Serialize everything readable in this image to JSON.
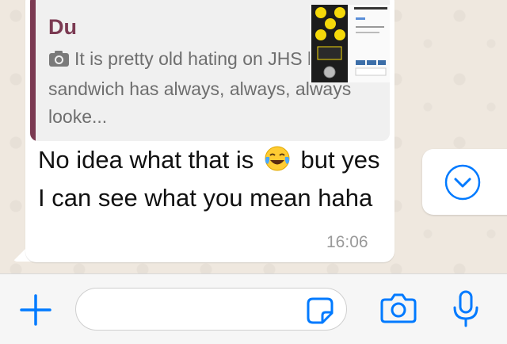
{
  "quote": {
    "author": "Du",
    "text": "It is pretty old hating on JHS but that sandwich has always, always, always looke..."
  },
  "message": {
    "text_before_emoji": "No idea what that is",
    "text_after_emoji": "but yes I can see what you mean haha",
    "emoji": "face-with-tears-of-joy-icon",
    "time": "16:06"
  },
  "colors": {
    "accent": "#007aff",
    "quote_author": "#7b3a52",
    "pedal_yellow": "#f5d90a"
  },
  "icons": {
    "scroll_down": "chevron-down-circle-icon",
    "attach": "plus-icon",
    "sticker": "sticker-icon",
    "camera": "camera-icon",
    "microphone": "microphone-icon"
  }
}
